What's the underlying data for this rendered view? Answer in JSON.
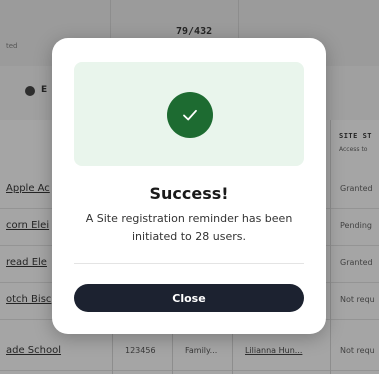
{
  "background": {
    "header_partial_text": "ted",
    "count": "79/432",
    "icon_label_partial": "E",
    "column_header": {
      "title": "SITE ST",
      "subtitle": "Access to"
    },
    "rows": [
      {
        "school": "Apple Ac",
        "status": "Granted"
      },
      {
        "school": "corn Elei",
        "status": "Pending"
      },
      {
        "school": "read Ele",
        "status": "Granted"
      },
      {
        "school": "otch Bisc",
        "status": "Not requ"
      },
      {
        "school": "ade School",
        "id": "123456",
        "type": "Family...",
        "contact": "Lilianna Hun...",
        "status": "Not requ"
      }
    ]
  },
  "modal": {
    "title": "Success!",
    "message_prefix": "A Site registration reminder has been initiated to ",
    "user_count": "28",
    "message_suffix": " users.",
    "close_label": "Close",
    "icon": "check-circle-icon",
    "accent_color": "#1d6b31"
  }
}
